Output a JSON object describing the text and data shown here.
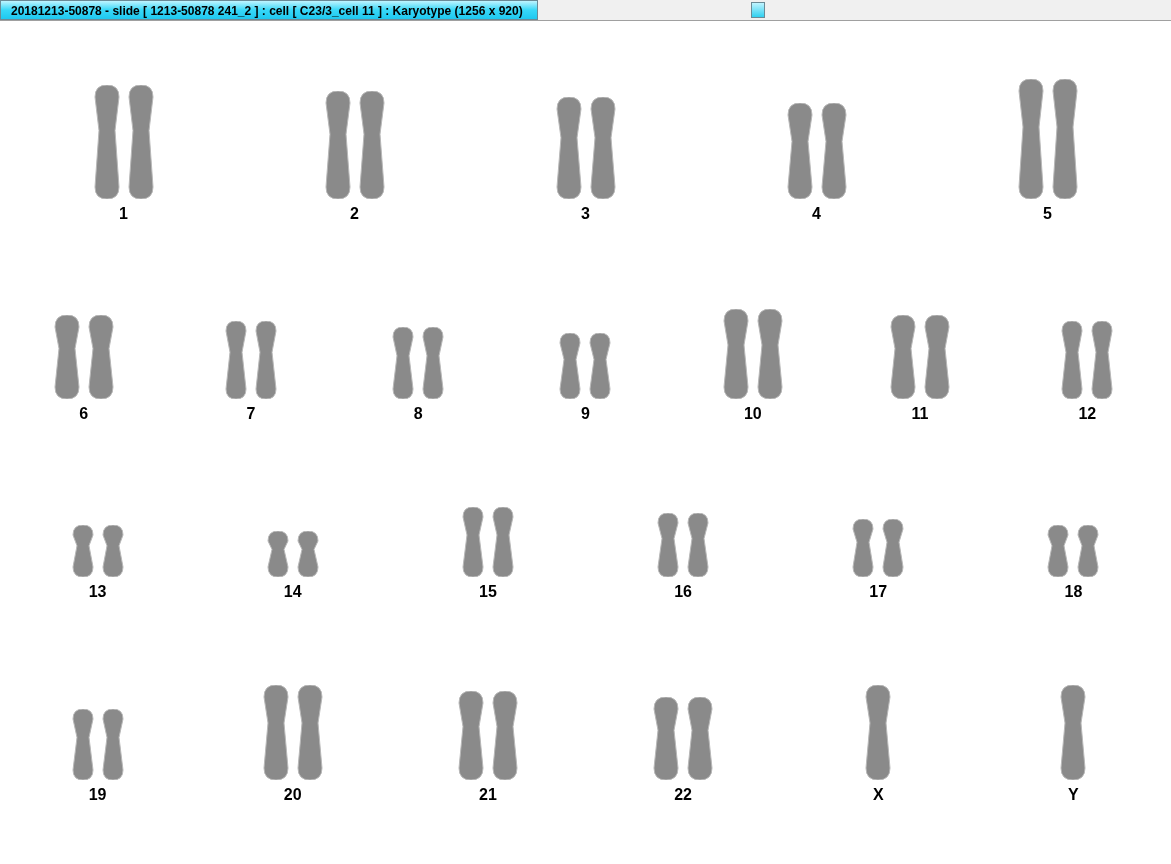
{
  "window": {
    "title": "20181213-50878 - slide [ 1213-50878 241_2 ] : cell [ C23/3_cell 11 ] : Karyotype  (1256 x 920)"
  },
  "karyotype": {
    "rows": [
      {
        "pairs": [
          {
            "label": "1"
          },
          {
            "label": "2"
          },
          {
            "label": "3"
          },
          {
            "label": "4"
          },
          {
            "label": "5"
          }
        ]
      },
      {
        "pairs": [
          {
            "label": "6"
          },
          {
            "label": "7"
          },
          {
            "label": "8"
          },
          {
            "label": "9"
          },
          {
            "label": "10"
          },
          {
            "label": "11"
          },
          {
            "label": "12"
          }
        ]
      },
      {
        "pairs": [
          {
            "label": "13"
          },
          {
            "label": "14"
          },
          {
            "label": "15"
          },
          {
            "label": "16"
          },
          {
            "label": "17"
          },
          {
            "label": "18"
          }
        ]
      },
      {
        "pairs": [
          {
            "label": "19"
          },
          {
            "label": "20"
          },
          {
            "label": "21"
          },
          {
            "label": "22"
          },
          {
            "label": "X",
            "kind": "single"
          },
          {
            "label": "Y",
            "kind": "single"
          }
        ]
      }
    ]
  }
}
